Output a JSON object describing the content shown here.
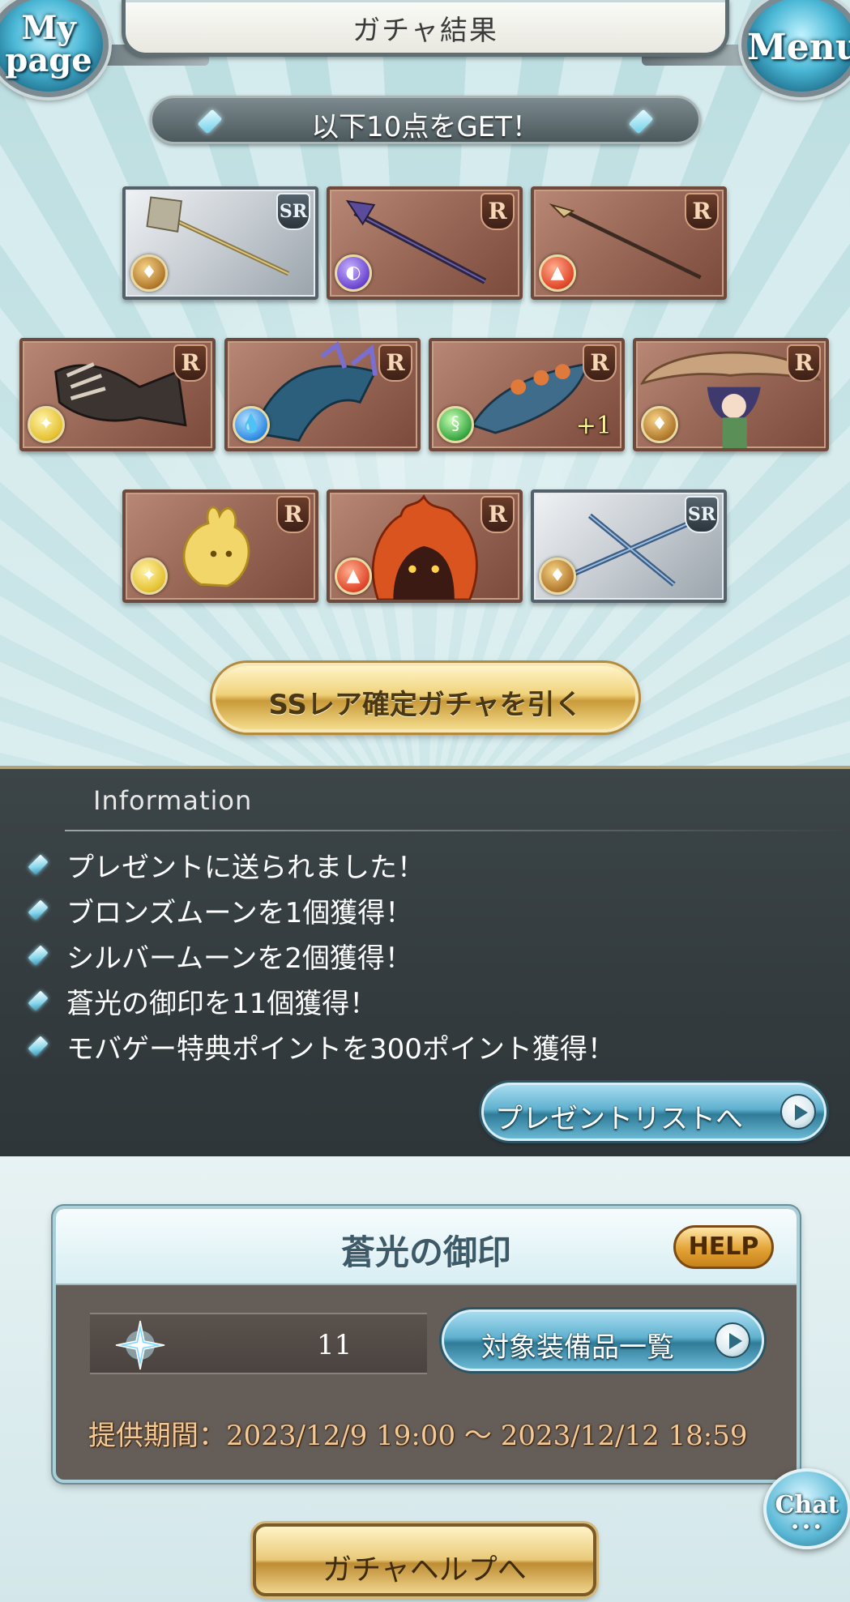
{
  "header": {
    "title": "ガチャ結果",
    "mypage_line1": "My",
    "mypage_line2": "page",
    "menu_label": "Menu"
  },
  "result": {
    "get_text": "以下10点をGET！"
  },
  "cards": [
    {
      "rarity": "SR",
      "element": "earth",
      "plus": ""
    },
    {
      "rarity": "R",
      "element": "dark",
      "plus": ""
    },
    {
      "rarity": "R",
      "element": "fire",
      "plus": ""
    },
    {
      "rarity": "R",
      "element": "light",
      "plus": ""
    },
    {
      "rarity": "R",
      "element": "water",
      "plus": ""
    },
    {
      "rarity": "R",
      "element": "wind",
      "plus": "+1"
    },
    {
      "rarity": "R",
      "element": "earth",
      "plus": ""
    },
    {
      "rarity": "R",
      "element": "light",
      "plus": ""
    },
    {
      "rarity": "R",
      "element": "fire",
      "plus": ""
    },
    {
      "rarity": "SR",
      "element": "earth",
      "plus": ""
    }
  ],
  "ss_button": {
    "label": "SSレア確定ガチャを引く"
  },
  "information": {
    "title": "Information",
    "items": [
      "プレゼントに送られました！",
      "ブロンズムーンを1個獲得！",
      "シルバームーンを2個獲得！",
      "蒼光の御印を11個獲得！",
      "モバゲー特典ポイントを300ポイント獲得！"
    ],
    "present_button": "プレゼントリストへ"
  },
  "seal": {
    "title": "蒼光の御印",
    "help_label": "HELP",
    "count": "11",
    "equip_button": "対象装備品一覧",
    "period": "提供期間：2023/12/9 19:00 ～ 2023/12/12 18:59"
  },
  "chat": {
    "label": "Chat",
    "dots": "•••"
  },
  "gacha_help": {
    "label": "ガチャヘルプへ"
  },
  "colors": {
    "info_bg": "#363e41",
    "gold_button": "#e9c979",
    "blue_button": "#5fb1cf",
    "period_text": "#f3c995"
  }
}
